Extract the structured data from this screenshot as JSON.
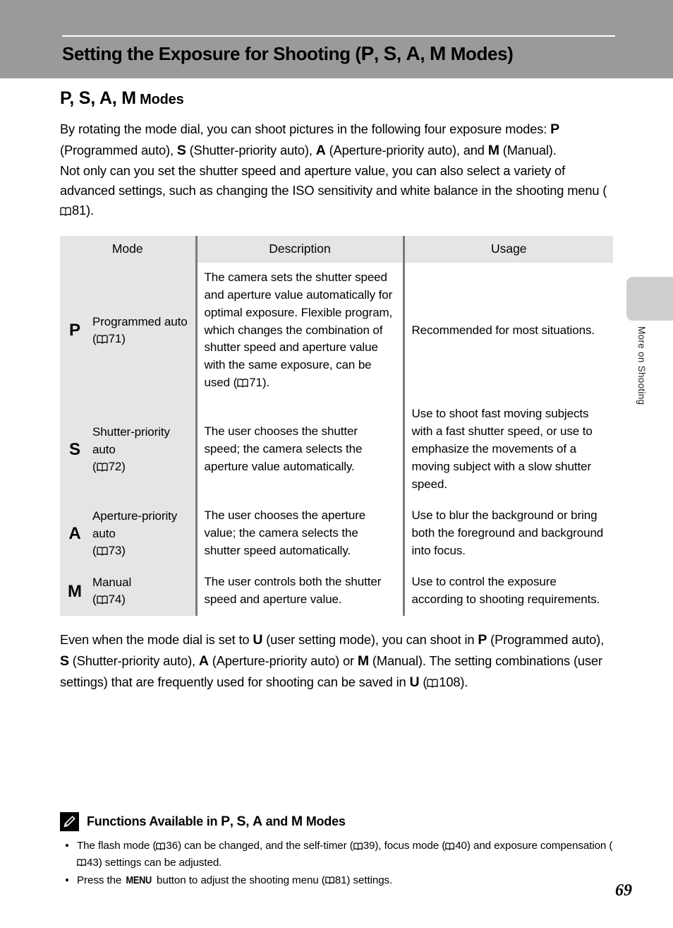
{
  "header": {
    "title_pre": "Setting the Exposure for Shooting (",
    "title_modes": [
      "P",
      "S",
      "A",
      "M"
    ],
    "title_post": " Modes)"
  },
  "side_tab": {
    "label": "More on Shooting"
  },
  "section": {
    "title_modes": [
      "P",
      "S",
      "A",
      "M"
    ],
    "title_suffix": " Modes"
  },
  "intro": {
    "para1_a": "By rotating the mode dial, you can shoot pictures in the following four exposure modes: ",
    "mode_p": "P",
    "para1_b": " (Programmed auto), ",
    "mode_s": "S",
    "para1_c": " (Shutter-priority auto), ",
    "mode_a": "A",
    "para1_d": " (Aperture-priority auto), and ",
    "mode_m": "M",
    "para1_e": " (Manual).",
    "para2_a": "Not only can you set the shutter speed and aperture value, you can also select a variety of advanced settings, such as changing the ISO sensitivity and white balance in the shooting menu (",
    "para2_ref": "81",
    "para2_b": ")."
  },
  "table": {
    "headers": [
      "Mode",
      "Description",
      "Usage"
    ],
    "rows": [
      {
        "letter": "P",
        "name": "Programmed auto",
        "ref": "71",
        "description_a": "The camera sets the shutter speed and aperture value automatically for optimal exposure. Flexible program, which changes the combination of shutter speed and aperture value with the same exposure, can be used (",
        "description_ref": "71",
        "description_b": ").",
        "usage": "Recommended for most situations."
      },
      {
        "letter": "S",
        "name": "Shutter-priority auto",
        "ref": "72",
        "description_a": "The user chooses the shutter speed; the camera selects the aperture value automatically.",
        "description_ref": "",
        "description_b": "",
        "usage": "Use to shoot fast moving subjects with a fast shutter speed, or use to emphasize the movements of a moving subject with a slow shutter speed."
      },
      {
        "letter": "A",
        "name": "Aperture-priority auto",
        "ref": "73",
        "description_a": "The user chooses the aperture value; the camera selects the shutter speed automatically.",
        "description_ref": "",
        "description_b": "",
        "usage": "Use to blur the background or bring both the foreground and background into focus."
      },
      {
        "letter": "M",
        "name": "Manual",
        "ref": "74",
        "description_a": "The user controls both the shutter speed and aperture value.",
        "description_ref": "",
        "description_b": "",
        "usage": "Use to control the exposure according to shooting requirements."
      }
    ]
  },
  "after_table": {
    "a": "Even when the mode dial is set to ",
    "mode_u1": "U",
    "b": " (user setting mode), you can shoot in ",
    "mode_p": "P",
    "c": " (Programmed auto), ",
    "mode_s": "S",
    "d": " (Shutter-priority auto), ",
    "mode_a": "A",
    "e": " (Aperture-priority auto) or ",
    "mode_m": "M",
    "f": " (Manual). The setting combinations (user settings) that are frequently used for shooting can be saved in ",
    "mode_u2": "U",
    "g": " (",
    "ref": "108",
    "h": ")."
  },
  "note": {
    "title_pre": "Functions Available in ",
    "title_modes": [
      "P",
      "S",
      "A"
    ],
    "title_and": " and ",
    "title_m": "M",
    "title_post": " Modes",
    "bullets": [
      {
        "a": "The flash mode (",
        "ref1": "36",
        "b": ") can be changed, and the self-timer (",
        "ref2": "39",
        "c": "), focus mode (",
        "ref3": "40",
        "d": ") and exposure compensation (",
        "ref4": "43",
        "e": ") settings can be adjusted."
      },
      {
        "a": "Press the ",
        "menu": "MENU",
        "b": " button to adjust the shooting menu (",
        "ref1": "81",
        "c": ") settings."
      }
    ]
  },
  "page_number": "69",
  "colors": {
    "header_band": "#9a9a9a",
    "table_border": "#7b7b7b",
    "mode_cell_bg": "#e5e5e5",
    "side_tab": "#cfcfcf"
  }
}
